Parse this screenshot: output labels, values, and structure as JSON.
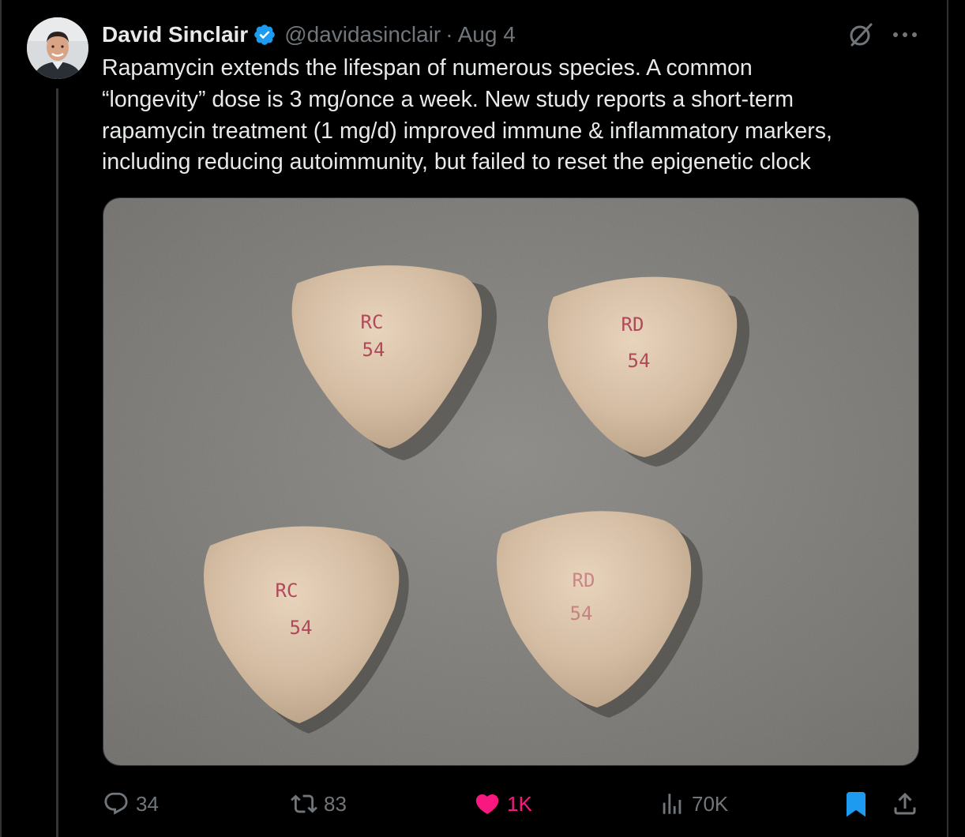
{
  "tweet": {
    "author": {
      "name": "David Sinclair",
      "handle": "@davidasinclair",
      "separator": "·",
      "date": "Aug 4",
      "avatar_icon": "avatar-photo"
    },
    "text_lines": [
      "Rapamycin extends the lifespan of numerous species. A common",
      "“longevity” dose is 3 mg/once a week. New study reports a short-term",
      "rapamycin treatment (1 mg/d) improved immune & inflammatory markers,",
      "including reducing autoimmunity, but failed to reset the epigenetic clock"
    ],
    "media": {
      "pills": [
        {
          "imprint_top": "RC",
          "imprint_bottom": "54"
        },
        {
          "imprint_top": "RD",
          "imprint_bottom": "54"
        },
        {
          "imprint_top": "RC",
          "imprint_bottom": "54"
        },
        {
          "imprint_top": "RD",
          "imprint_bottom": "54"
        }
      ]
    },
    "actions": {
      "replies": "34",
      "reposts": "83",
      "likes": "1K",
      "views": "70K"
    }
  },
  "icons": {
    "verified": "verified-badge-icon",
    "grok": "grok-icon",
    "more": "more-dots-icon",
    "reply": "reply-icon",
    "repost": "repost-icon",
    "like": "heart-icon",
    "views": "views-chart-icon",
    "bookmark": "bookmark-icon",
    "share": "share-icon"
  },
  "colors": {
    "background": "#000000",
    "text": "#e7e9ea",
    "secondary": "#71767b",
    "verified": "#1d9bf0",
    "like": "#f91880",
    "bookmark": "#1d9bf0",
    "pill_ink": "#a8324a"
  }
}
